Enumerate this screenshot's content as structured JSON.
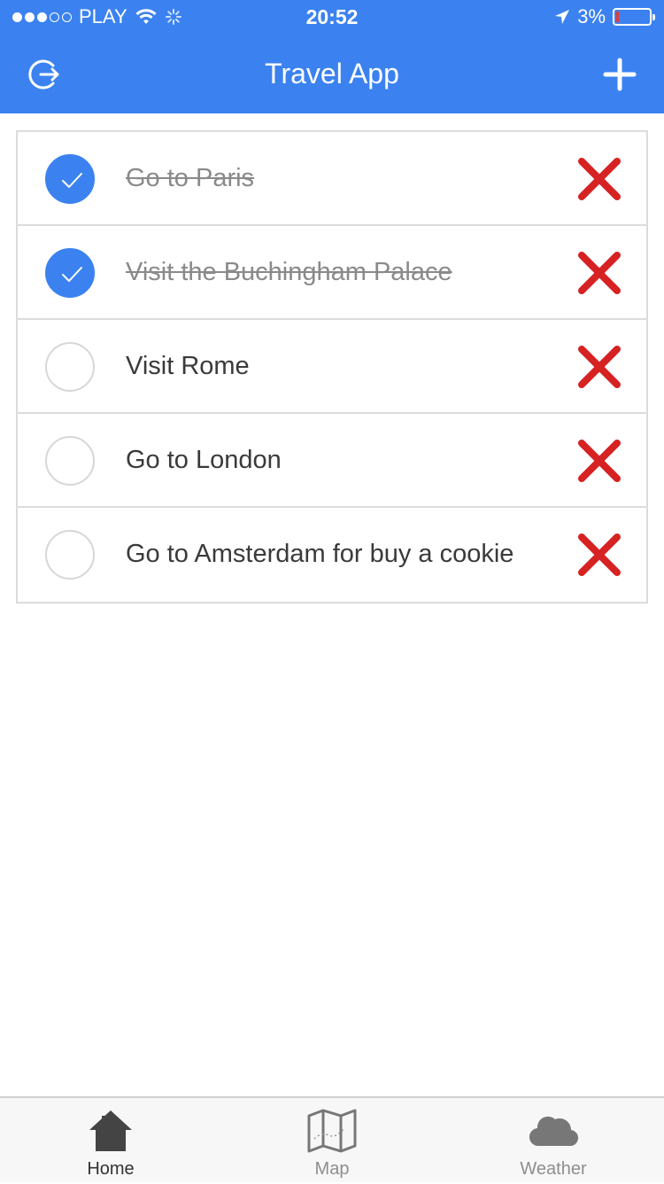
{
  "status_bar": {
    "carrier": "PLAY",
    "time": "20:52",
    "battery_percent": "3%",
    "battery_level": 0.03,
    "signal_bars_filled": 3,
    "signal_bars_total": 5,
    "icons": [
      "wifi-icon",
      "activity-spinner-icon",
      "location-arrow-icon",
      "battery-icon"
    ]
  },
  "nav": {
    "title": "Travel App",
    "left_icon": "logout-icon",
    "right_icon": "plus-icon"
  },
  "colors": {
    "brand": "#3b82f0",
    "delete": "#d62222",
    "done_text": "#8a8a8a"
  },
  "items": [
    {
      "label": "Go to Paris",
      "done": true
    },
    {
      "label": "Visit the Buchingham Palace",
      "done": true
    },
    {
      "label": "Visit Rome",
      "done": false
    },
    {
      "label": "Go to London",
      "done": false
    },
    {
      "label": "Go to Amsterdam for buy a cookie",
      "done": false
    }
  ],
  "tabs": [
    {
      "label": "Home",
      "icon": "home-icon",
      "active": true
    },
    {
      "label": "Map",
      "icon": "map-icon",
      "active": false
    },
    {
      "label": "Weather",
      "icon": "cloud-icon",
      "active": false
    }
  ]
}
